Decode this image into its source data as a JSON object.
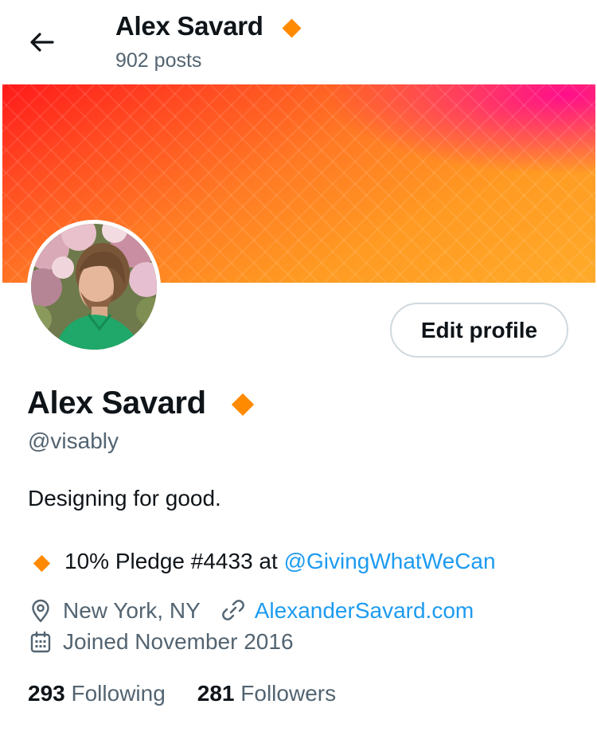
{
  "header": {
    "name": "Alex Savard",
    "posts_count": "902",
    "posts_label": "posts"
  },
  "profile": {
    "edit_button_label": "Edit profile",
    "display_name": "Alex Savard",
    "handle": "@visably",
    "bio": "Designing for good.",
    "pledge_text": "10% Pledge #4433 at ",
    "pledge_link": "@GivingWhatWeCan",
    "location": "New York, NY",
    "website": "AlexanderSavard.com",
    "joined": "Joined November 2016",
    "following_count": "293",
    "following_label": "Following",
    "followers_count": "281",
    "followers_label": "Followers"
  },
  "icons": {
    "back": "arrow-left-icon",
    "verified": "orange-diamond-badge-icon",
    "location": "map-pin-icon",
    "link": "link-icon",
    "calendar": "calendar-icon"
  },
  "colors": {
    "accent_link": "#1d9bf0",
    "badge": "#ff8a00",
    "secondary_text": "#536471",
    "primary_text": "#0f1419"
  }
}
